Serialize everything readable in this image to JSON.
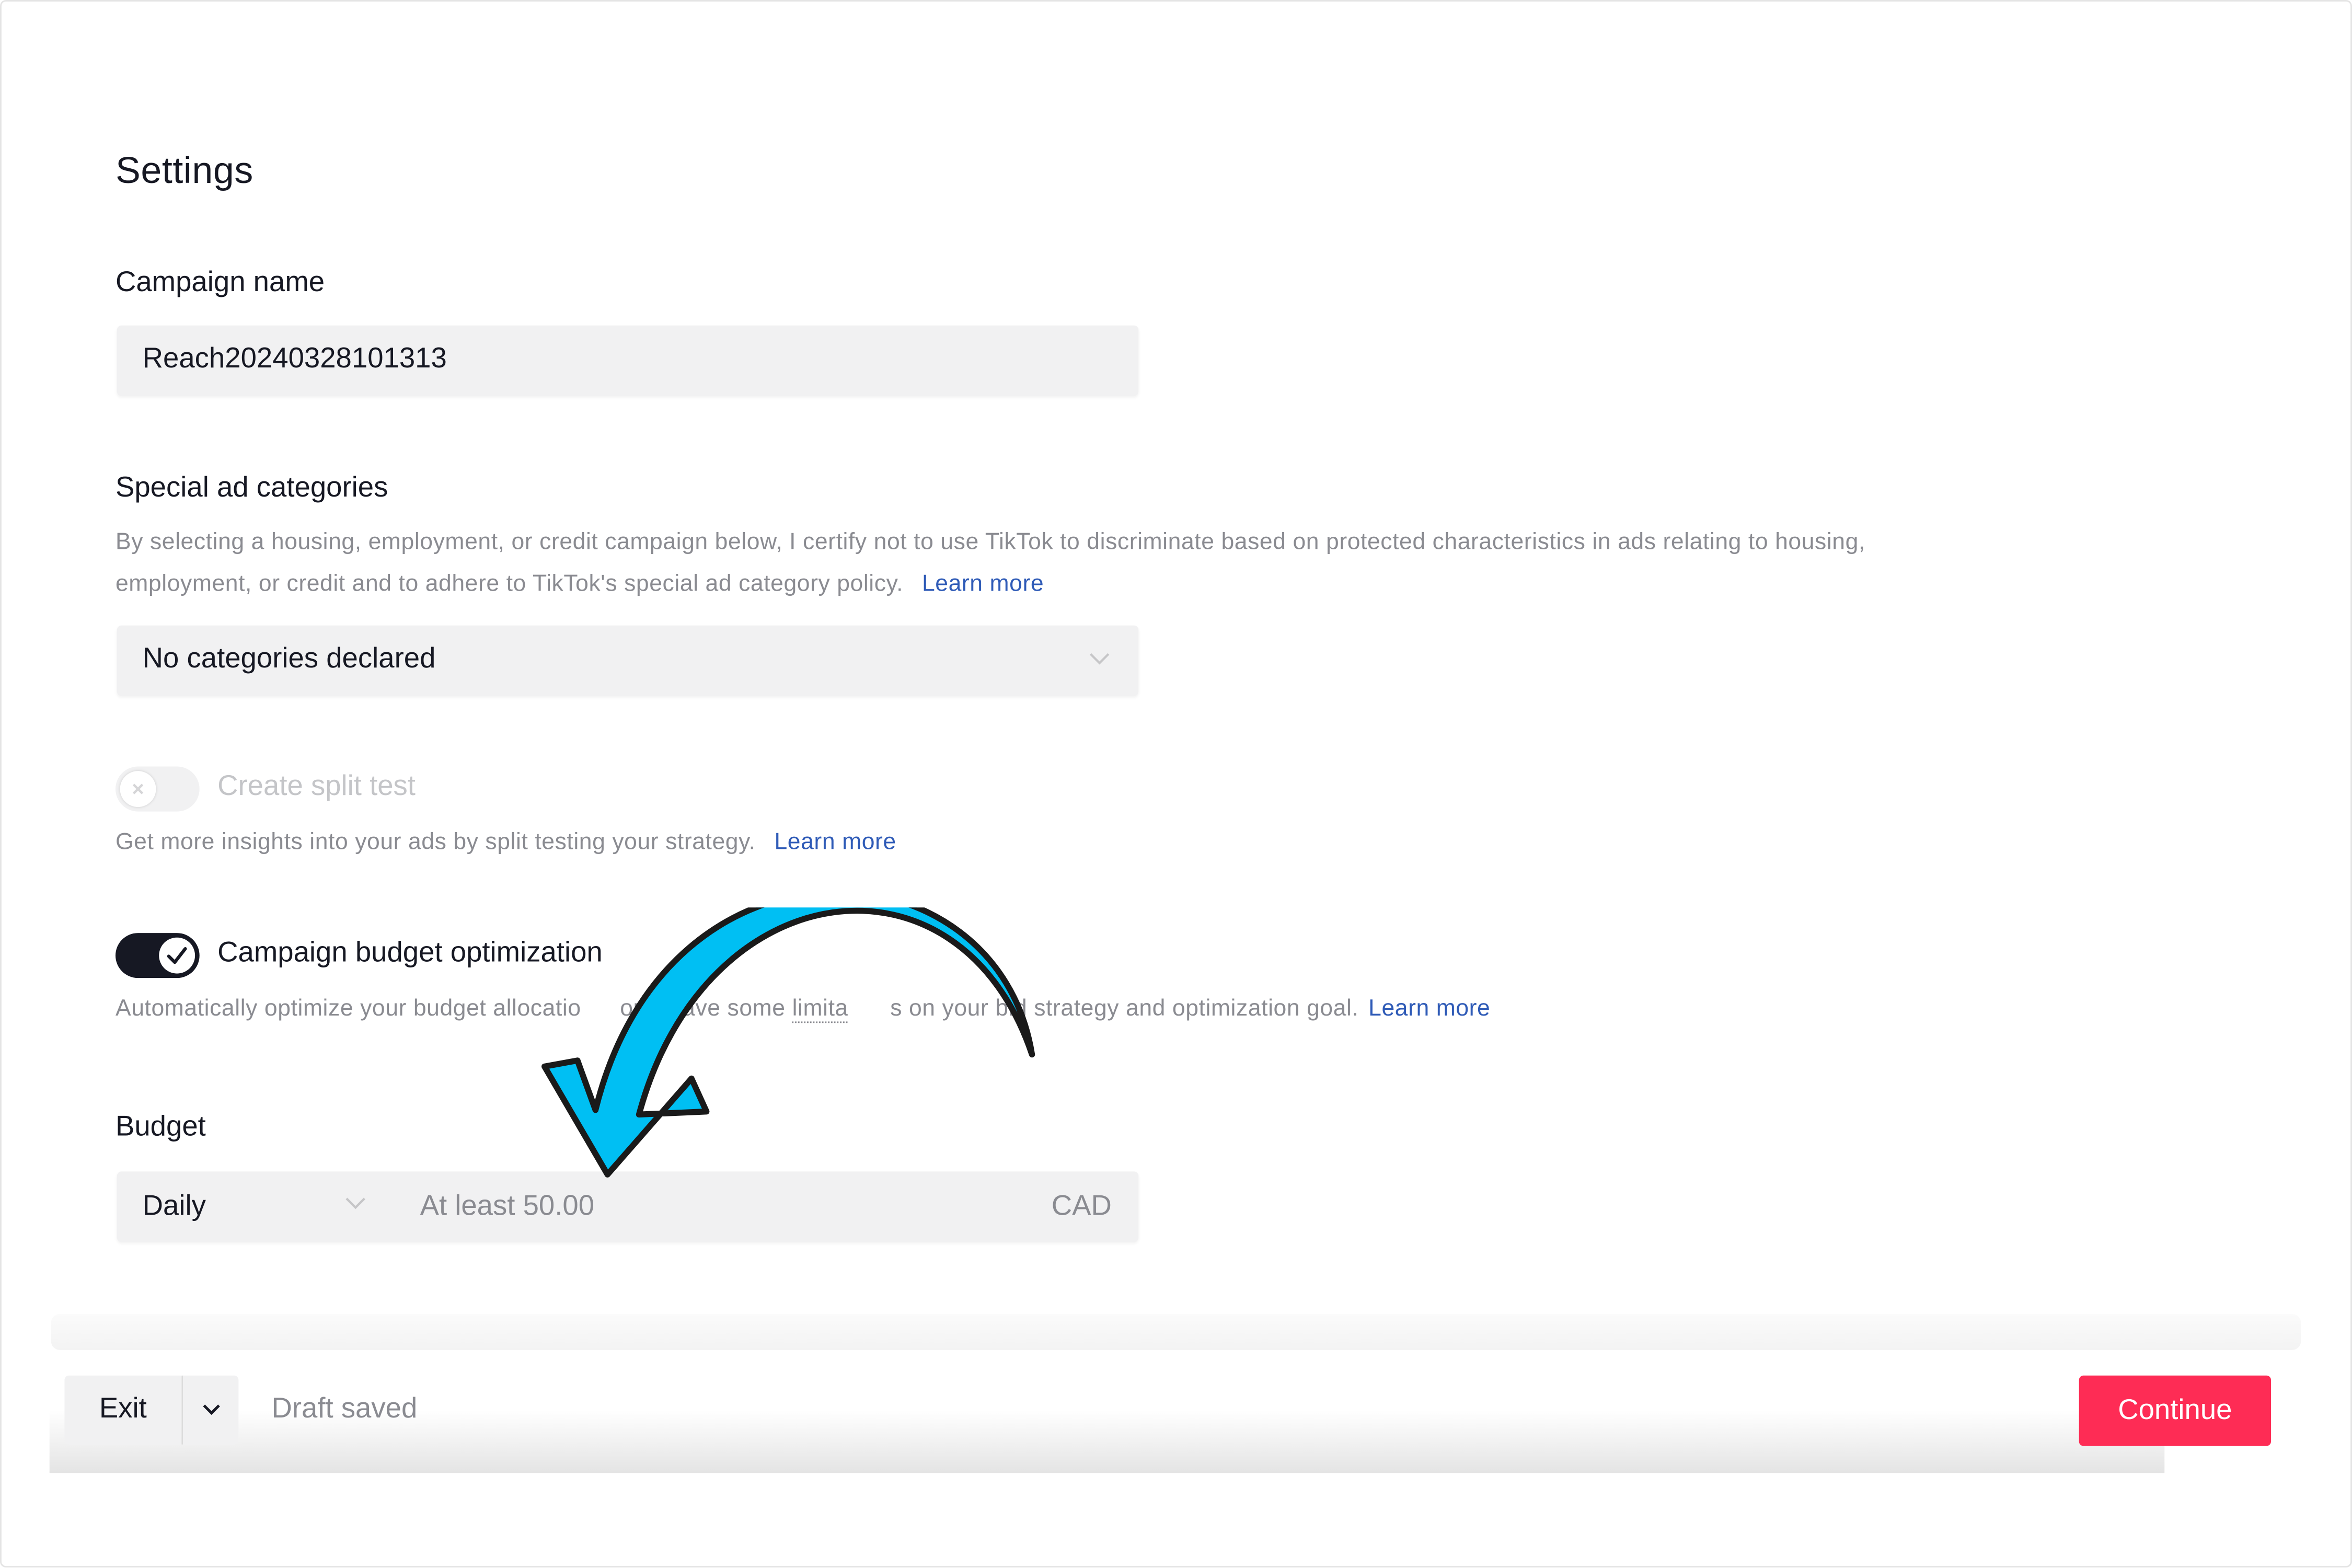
{
  "page": {
    "title": "Settings"
  },
  "campaign_name": {
    "label": "Campaign name",
    "value": "Reach20240328101313"
  },
  "special_ad_categories": {
    "label": "Special ad categories",
    "description_line1": "By selecting a housing, employment, or credit campaign below, I certify not to use TikTok to discriminate based on protected characteristics in ads relating to housing,",
    "description_line2": "employment, or credit and to adhere to TikTok's special ad category policy.",
    "learn_more": "Learn more",
    "selected": "No categories declared"
  },
  "split_test": {
    "label": "Create split test",
    "enabled": false,
    "description": "Get more insights into your ads by split testing your strategy.",
    "learn_more": "Learn more"
  },
  "budget_optimization": {
    "label": "Campaign budget optimization",
    "enabled": true,
    "description_start": "Automatically optimize your budget allocatio",
    "description_mid": "ou'll have some ",
    "description_dotted": "limita",
    "description_end": "s on your bid strategy and optimization goal.",
    "learn_more": "Learn more"
  },
  "budget": {
    "label": "Budget",
    "mode": "Daily",
    "amount_placeholder": "At least 50.00",
    "currency": "CAD"
  },
  "footer": {
    "exit_label": "Exit",
    "status": "Draft saved",
    "continue_label": "Continue"
  },
  "annotation": {
    "arrow_color": "#00bff3",
    "arrow_icon": "curved-arrow"
  },
  "colors": {
    "primary": "#fe2c55",
    "link": "#2f5bb7",
    "toggle_on": "#161823"
  }
}
